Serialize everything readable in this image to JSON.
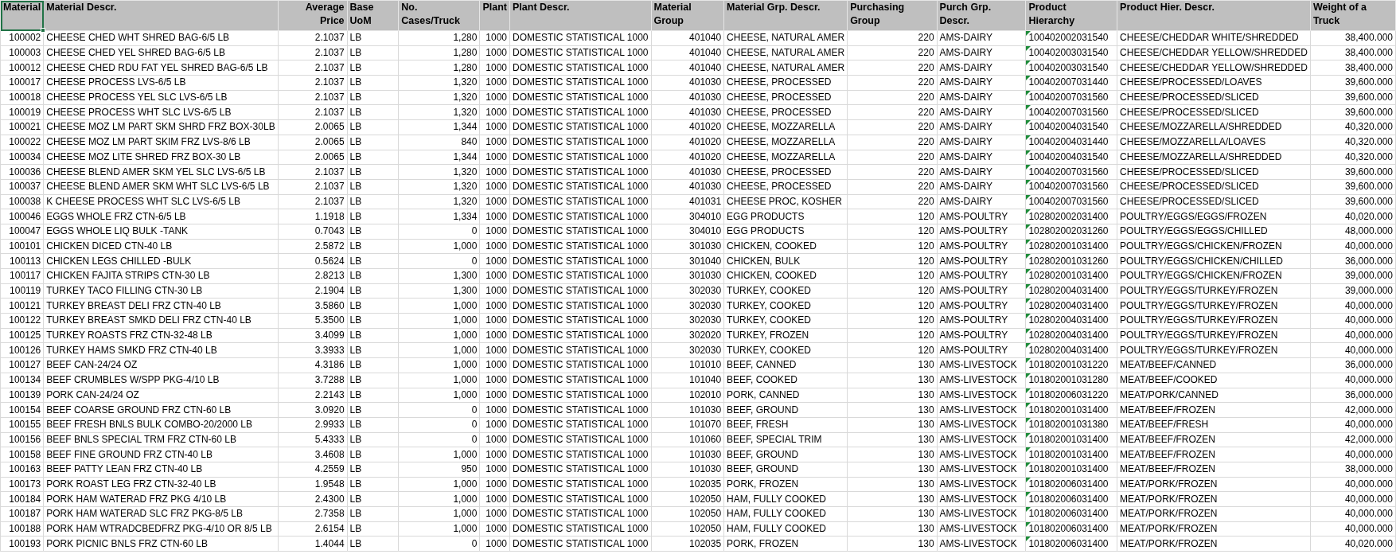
{
  "table": {
    "columns": [
      {
        "label": "Material",
        "kind": "plain",
        "selected": true
      },
      {
        "label": "Material Descr.",
        "kind": "plain",
        "selected": false
      },
      {
        "label": "Average Price",
        "kind": "plain",
        "selected": false
      },
      {
        "label": "Base UoM",
        "kind": "plain",
        "selected": false
      },
      {
        "label": "No. Cases/Truck",
        "kind": "plain",
        "selected": false
      },
      {
        "label": "Plant",
        "kind": "plain",
        "selected": false
      },
      {
        "label": "Plant Descr.",
        "kind": "plain",
        "selected": false
      },
      {
        "label": "Material Group",
        "kind": "plain",
        "selected": false
      },
      {
        "label": "Material Grp. Descr.",
        "kind": "plain",
        "selected": false
      },
      {
        "label": "Purchasing Group",
        "kind": "plain",
        "selected": false
      },
      {
        "label": "Purch Grp. Descr.",
        "kind": "plain",
        "selected": false
      },
      {
        "label": "Product Hierarchy",
        "kind": "number-as-text",
        "selected": false
      },
      {
        "label": "Product Hier. Descr.",
        "kind": "plain",
        "selected": false
      },
      {
        "label": "Weight of a Truck",
        "kind": "plain",
        "selected": false
      }
    ],
    "rows": [
      [
        "100002",
        "CHEESE CHED WHT SHRED BAG-6/5 LB",
        "2.1037",
        "LB",
        "1,280",
        "1000",
        "DOMESTIC STATISTICAL 1000",
        "401040",
        "CHEESE, NATURAL AMER",
        "220",
        "AMS-DAIRY",
        "100402002031540",
        "CHEESE/CHEDDAR WHITE/SHREDDED",
        "38,400.000"
      ],
      [
        "100003",
        "CHEESE CHED YEL SHRED BAG-6/5 LB",
        "2.1037",
        "LB",
        "1,280",
        "1000",
        "DOMESTIC STATISTICAL 1000",
        "401040",
        "CHEESE, NATURAL AMER",
        "220",
        "AMS-DAIRY",
        "100402003031540",
        "CHEESE/CHEDDAR YELLOW/SHREDDED",
        "38,400.000"
      ],
      [
        "100012",
        "CHEESE CHED RDU FAT YEL SHRED BAG-6/5 LB",
        "2.1037",
        "LB",
        "1,280",
        "1000",
        "DOMESTIC STATISTICAL 1000",
        "401040",
        "CHEESE, NATURAL AMER",
        "220",
        "AMS-DAIRY",
        "100402003031540",
        "CHEESE/CHEDDAR YELLOW/SHREDDED",
        "38,400.000"
      ],
      [
        "100017",
        "CHEESE PROCESS LVS-6/5 LB",
        "2.1037",
        "LB",
        "1,320",
        "1000",
        "DOMESTIC STATISTICAL 1000",
        "401030",
        "CHEESE, PROCESSED",
        "220",
        "AMS-DAIRY",
        "100402007031440",
        "CHEESE/PROCESSED/LOAVES",
        "39,600.000"
      ],
      [
        "100018",
        "CHEESE PROCESS YEL SLC LVS-6/5 LB",
        "2.1037",
        "LB",
        "1,320",
        "1000",
        "DOMESTIC STATISTICAL 1000",
        "401030",
        "CHEESE, PROCESSED",
        "220",
        "AMS-DAIRY",
        "100402007031560",
        "CHEESE/PROCESSED/SLICED",
        "39,600.000"
      ],
      [
        "100019",
        "CHEESE PROCESS WHT SLC LVS-6/5 LB",
        "2.1037",
        "LB",
        "1,320",
        "1000",
        "DOMESTIC STATISTICAL 1000",
        "401030",
        "CHEESE, PROCESSED",
        "220",
        "AMS-DAIRY",
        "100402007031560",
        "CHEESE/PROCESSED/SLICED",
        "39,600.000"
      ],
      [
        "100021",
        "CHEESE MOZ LM PART SKM SHRD FRZ BOX-30LB",
        "2.0065",
        "LB",
        "1,344",
        "1000",
        "DOMESTIC STATISTICAL 1000",
        "401020",
        "CHEESE, MOZZARELLA",
        "220",
        "AMS-DAIRY",
        "100402004031540",
        "CHEESE/MOZZARELLA/SHREDDED",
        "40,320.000"
      ],
      [
        "100022",
        "CHEESE MOZ LM PART SKIM FRZ LVS-8/6 LB",
        "2.0065",
        "LB",
        "840",
        "1000",
        "DOMESTIC STATISTICAL 1000",
        "401020",
        "CHEESE, MOZZARELLA",
        "220",
        "AMS-DAIRY",
        "100402004031440",
        "CHEESE/MOZZARELLA/LOAVES",
        "40,320.000"
      ],
      [
        "100034",
        "CHEESE MOZ LITE SHRED FRZ BOX-30 LB",
        "2.0065",
        "LB",
        "1,344",
        "1000",
        "DOMESTIC STATISTICAL 1000",
        "401020",
        "CHEESE, MOZZARELLA",
        "220",
        "AMS-DAIRY",
        "100402004031540",
        "CHEESE/MOZZARELLA/SHREDDED",
        "40,320.000"
      ],
      [
        "100036",
        "CHEESE BLEND AMER SKM YEL SLC LVS-6/5 LB",
        "2.1037",
        "LB",
        "1,320",
        "1000",
        "DOMESTIC STATISTICAL 1000",
        "401030",
        "CHEESE, PROCESSED",
        "220",
        "AMS-DAIRY",
        "100402007031560",
        "CHEESE/PROCESSED/SLICED",
        "39,600.000"
      ],
      [
        "100037",
        "CHEESE BLEND AMER SKM WHT SLC LVS-6/5 LB",
        "2.1037",
        "LB",
        "1,320",
        "1000",
        "DOMESTIC STATISTICAL 1000",
        "401030",
        "CHEESE, PROCESSED",
        "220",
        "AMS-DAIRY",
        "100402007031560",
        "CHEESE/PROCESSED/SLICED",
        "39,600.000"
      ],
      [
        "100038",
        "K CHEESE PROCESS WHT SLC LVS-6/5 LB",
        "2.1037",
        "LB",
        "1,320",
        "1000",
        "DOMESTIC STATISTICAL 1000",
        "401031",
        "CHEESE PROC, KOSHER",
        "220",
        "AMS-DAIRY",
        "100402007031560",
        "CHEESE/PROCESSED/SLICED",
        "39,600.000"
      ],
      [
        "100046",
        "EGGS WHOLE FRZ CTN-6/5 LB",
        "1.1918",
        "LB",
        "1,334",
        "1000",
        "DOMESTIC STATISTICAL 1000",
        "304010",
        "EGG PRODUCTS",
        "120",
        "AMS-POULTRY",
        "102802002031400",
        "POULTRY/EGGS/EGGS/FROZEN",
        "40,020.000"
      ],
      [
        "100047",
        "EGGS WHOLE LIQ BULK -TANK",
        "0.7043",
        "LB",
        "0",
        "1000",
        "DOMESTIC STATISTICAL 1000",
        "304010",
        "EGG PRODUCTS",
        "120",
        "AMS-POULTRY",
        "102802002031260",
        "POULTRY/EGGS/EGGS/CHILLED",
        "48,000.000"
      ],
      [
        "100101",
        "CHICKEN DICED CTN-40 LB",
        "2.5872",
        "LB",
        "1,000",
        "1000",
        "DOMESTIC STATISTICAL 1000",
        "301030",
        "CHICKEN, COOKED",
        "120",
        "AMS-POULTRY",
        "102802001031400",
        "POULTRY/EGGS/CHICKEN/FROZEN",
        "40,000.000"
      ],
      [
        "100113",
        "CHICKEN LEGS CHILLED -BULK",
        "0.5624",
        "LB",
        "0",
        "1000",
        "DOMESTIC STATISTICAL 1000",
        "301040",
        "CHICKEN, BULK",
        "120",
        "AMS-POULTRY",
        "102802001031260",
        "POULTRY/EGGS/CHICKEN/CHILLED",
        "36,000.000"
      ],
      [
        "100117",
        "CHICKEN FAJITA STRIPS CTN-30 LB",
        "2.8213",
        "LB",
        "1,300",
        "1000",
        "DOMESTIC STATISTICAL 1000",
        "301030",
        "CHICKEN, COOKED",
        "120",
        "AMS-POULTRY",
        "102802001031400",
        "POULTRY/EGGS/CHICKEN/FROZEN",
        "39,000.000"
      ],
      [
        "100119",
        "TURKEY TACO FILLING CTN-30 LB",
        "2.1904",
        "LB",
        "1,300",
        "1000",
        "DOMESTIC STATISTICAL 1000",
        "302030",
        "TURKEY, COOKED",
        "120",
        "AMS-POULTRY",
        "102802004031400",
        "POULTRY/EGGS/TURKEY/FROZEN",
        "39,000.000"
      ],
      [
        "100121",
        "TURKEY BREAST DELI FRZ CTN-40 LB",
        "3.5860",
        "LB",
        "1,000",
        "1000",
        "DOMESTIC STATISTICAL 1000",
        "302030",
        "TURKEY, COOKED",
        "120",
        "AMS-POULTRY",
        "102802004031400",
        "POULTRY/EGGS/TURKEY/FROZEN",
        "40,000.000"
      ],
      [
        "100122",
        "TURKEY BREAST SMKD DELI FRZ CTN-40 LB",
        "5.3500",
        "LB",
        "1,000",
        "1000",
        "DOMESTIC STATISTICAL 1000",
        "302030",
        "TURKEY, COOKED",
        "120",
        "AMS-POULTRY",
        "102802004031400",
        "POULTRY/EGGS/TURKEY/FROZEN",
        "40,000.000"
      ],
      [
        "100125",
        "TURKEY ROASTS FRZ CTN-32-48 LB",
        "3.4099",
        "LB",
        "1,000",
        "1000",
        "DOMESTIC STATISTICAL 1000",
        "302020",
        "TURKEY, FROZEN",
        "120",
        "AMS-POULTRY",
        "102802004031400",
        "POULTRY/EGGS/TURKEY/FROZEN",
        "40,000.000"
      ],
      [
        "100126",
        "TURKEY HAMS SMKD FRZ CTN-40 LB",
        "3.3933",
        "LB",
        "1,000",
        "1000",
        "DOMESTIC STATISTICAL 1000",
        "302030",
        "TURKEY, COOKED",
        "120",
        "AMS-POULTRY",
        "102802004031400",
        "POULTRY/EGGS/TURKEY/FROZEN",
        "40,000.000"
      ],
      [
        "100127",
        "BEEF CAN-24/24 OZ",
        "4.3186",
        "LB",
        "1,000",
        "1000",
        "DOMESTIC STATISTICAL 1000",
        "101010",
        "BEEF, CANNED",
        "130",
        "AMS-LIVESTOCK",
        "101802001031220",
        "MEAT/BEEF/CANNED",
        "36,000.000"
      ],
      [
        "100134",
        "BEEF CRUMBLES W/SPP PKG-4/10 LB",
        "3.7288",
        "LB",
        "1,000",
        "1000",
        "DOMESTIC STATISTICAL 1000",
        "101040",
        "BEEF, COOKED",
        "130",
        "AMS-LIVESTOCK",
        "101802001031280",
        "MEAT/BEEF/COOKED",
        "40,000.000"
      ],
      [
        "100139",
        "PORK CAN-24/24 OZ",
        "2.2143",
        "LB",
        "1,000",
        "1000",
        "DOMESTIC STATISTICAL 1000",
        "102010",
        "PORK, CANNED",
        "130",
        "AMS-LIVESTOCK",
        "101802006031220",
        "MEAT/PORK/CANNED",
        "36,000.000"
      ],
      [
        "100154",
        "BEEF COARSE GROUND FRZ CTN-60 LB",
        "3.0920",
        "LB",
        "0",
        "1000",
        "DOMESTIC STATISTICAL 1000",
        "101030",
        "BEEF, GROUND",
        "130",
        "AMS-LIVESTOCK",
        "101802001031400",
        "MEAT/BEEF/FROZEN",
        "42,000.000"
      ],
      [
        "100155",
        "BEEF FRESH BNLS BULK COMBO-20/2000 LB",
        "2.9933",
        "LB",
        "0",
        "1000",
        "DOMESTIC STATISTICAL 1000",
        "101070",
        "BEEF, FRESH",
        "130",
        "AMS-LIVESTOCK",
        "101802001031380",
        "MEAT/BEEF/FRESH",
        "40,000.000"
      ],
      [
        "100156",
        "BEEF BNLS SPECIAL TRM FRZ CTN-60 LB",
        "5.4333",
        "LB",
        "0",
        "1000",
        "DOMESTIC STATISTICAL 1000",
        "101060",
        "BEEF, SPECIAL TRIM",
        "130",
        "AMS-LIVESTOCK",
        "101802001031400",
        "MEAT/BEEF/FROZEN",
        "42,000.000"
      ],
      [
        "100158",
        "BEEF FINE GROUND FRZ CTN-40 LB",
        "3.4608",
        "LB",
        "1,000",
        "1000",
        "DOMESTIC STATISTICAL 1000",
        "101030",
        "BEEF, GROUND",
        "130",
        "AMS-LIVESTOCK",
        "101802001031400",
        "MEAT/BEEF/FROZEN",
        "40,000.000"
      ],
      [
        "100163",
        "BEEF PATTY LEAN FRZ CTN-40 LB",
        "4.2559",
        "LB",
        "950",
        "1000",
        "DOMESTIC STATISTICAL 1000",
        "101030",
        "BEEF, GROUND",
        "130",
        "AMS-LIVESTOCK",
        "101802001031400",
        "MEAT/BEEF/FROZEN",
        "38,000.000"
      ],
      [
        "100173",
        "PORK ROAST LEG FRZ CTN-32-40 LB",
        "1.9548",
        "LB",
        "1,000",
        "1000",
        "DOMESTIC STATISTICAL 1000",
        "102035",
        "PORK, FROZEN",
        "130",
        "AMS-LIVESTOCK",
        "101802006031400",
        "MEAT/PORK/FROZEN",
        "40,000.000"
      ],
      [
        "100184",
        "PORK HAM WATERAD FRZ PKG 4/10 LB",
        "2.4300",
        "LB",
        "1,000",
        "1000",
        "DOMESTIC STATISTICAL 1000",
        "102050",
        "HAM, FULLY COOKED",
        "130",
        "AMS-LIVESTOCK",
        "101802006031400",
        "MEAT/PORK/FROZEN",
        "40,000.000"
      ],
      [
        "100187",
        "PORK HAM WATERAD SLC FRZ PKG-8/5 LB",
        "2.7358",
        "LB",
        "1,000",
        "1000",
        "DOMESTIC STATISTICAL 1000",
        "102050",
        "HAM, FULLY COOKED",
        "130",
        "AMS-LIVESTOCK",
        "101802006031400",
        "MEAT/PORK/FROZEN",
        "40,000.000"
      ],
      [
        "100188",
        "PORK HAM WTRADCBEDFRZ PKG-4/10 OR 8/5 LB",
        "2.6154",
        "LB",
        "1,000",
        "1000",
        "DOMESTIC STATISTICAL 1000",
        "102050",
        "HAM, FULLY COOKED",
        "130",
        "AMS-LIVESTOCK",
        "101802006031400",
        "MEAT/PORK/FROZEN",
        "40,000.000"
      ],
      [
        "100193",
        "PORK PICNIC BNLS FRZ CTN-60 LB",
        "1.4044",
        "LB",
        "0",
        "1000",
        "DOMESTIC STATISTICAL 1000",
        "102035",
        "PORK, FROZEN",
        "130",
        "AMS-LIVESTOCK",
        "101802006031400",
        "MEAT/PORK/FROZEN",
        "40,020.000"
      ]
    ]
  }
}
